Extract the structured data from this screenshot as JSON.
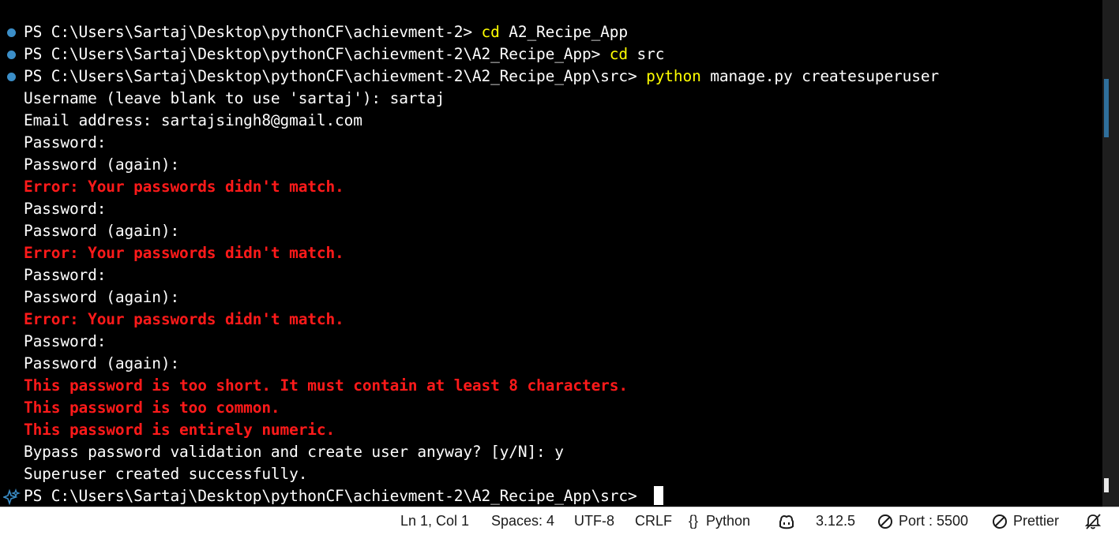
{
  "terminal": {
    "lines": [
      {
        "type": "prompt",
        "prompt": "PS C:\\Users\\Sartaj\\Desktop\\pythonCF\\achievment-2> ",
        "command": "cd",
        "args": " A2_Recipe_App"
      },
      {
        "type": "prompt",
        "prompt": "PS C:\\Users\\Sartaj\\Desktop\\pythonCF\\achievment-2\\A2_Recipe_App> ",
        "command": "cd",
        "args": " src"
      },
      {
        "type": "prompt",
        "prompt": "PS C:\\Users\\Sartaj\\Desktop\\pythonCF\\achievment-2\\A2_Recipe_App\\src> ",
        "command": "python",
        "args": " manage.py createsuperuser"
      },
      {
        "type": "output",
        "text": "Username (leave blank to use 'sartaj'): sartaj"
      },
      {
        "type": "output",
        "text": "Email address: sartajsingh8@gmail.com"
      },
      {
        "type": "output",
        "text": "Password:"
      },
      {
        "type": "output",
        "text": "Password (again):"
      },
      {
        "type": "error",
        "text": "Error: Your passwords didn't match."
      },
      {
        "type": "output",
        "text": "Password:"
      },
      {
        "type": "output",
        "text": "Password (again):"
      },
      {
        "type": "error",
        "text": "Error: Your passwords didn't match."
      },
      {
        "type": "output",
        "text": "Password:"
      },
      {
        "type": "output",
        "text": "Password (again):"
      },
      {
        "type": "error",
        "text": "Error: Your passwords didn't match."
      },
      {
        "type": "output",
        "text": "Password:"
      },
      {
        "type": "output",
        "text": "Password (again):"
      },
      {
        "type": "error",
        "text": "This password is too short. It must contain at least 8 characters."
      },
      {
        "type": "error",
        "text": "This password is too common."
      },
      {
        "type": "error",
        "text": "This password is entirely numeric."
      },
      {
        "type": "output",
        "text": "Bypass password validation and create user anyway? [y/N]: y"
      },
      {
        "type": "output",
        "text": "Superuser created successfully."
      },
      {
        "type": "current",
        "prompt": "PS C:\\Users\\Sartaj\\Desktop\\pythonCF\\achievment-2\\A2_Recipe_App\\src> "
      }
    ]
  },
  "statusbar": {
    "position": "Ln 1, Col 1",
    "spaces": "Spaces: 4",
    "encoding": "UTF-8",
    "eol": "CRLF",
    "language": "Python",
    "language_icon": "{}",
    "copilot_icon": "copilot-icon",
    "python_version": "3.12.5",
    "port": "Port : 5500",
    "prettier": "Prettier",
    "notifications_icon": "bell-muted-icon"
  },
  "colors": {
    "background": "#000000",
    "foreground": "#ffffff",
    "command": "#ffff00",
    "error": "#ff1a1a",
    "decoration_dot": "#3b8ec8",
    "statusbar_bg": "#ffffff"
  }
}
